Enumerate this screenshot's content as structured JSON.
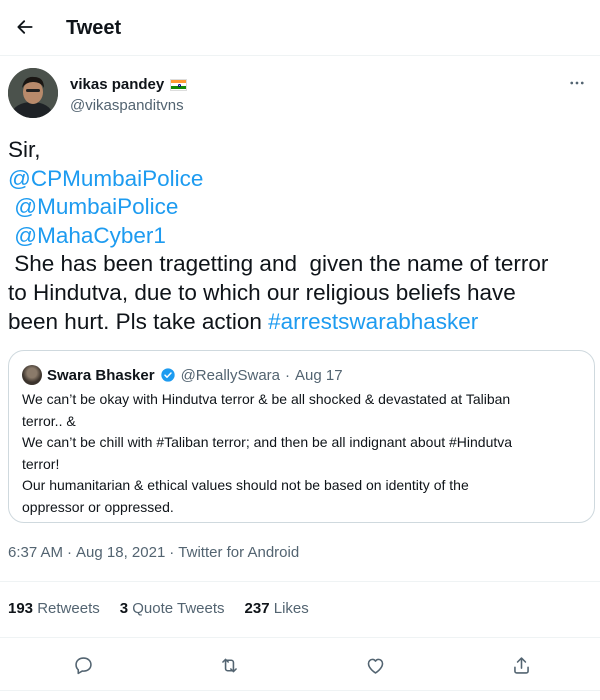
{
  "header": {
    "title": "Tweet"
  },
  "author": {
    "name": "vikas pandey",
    "handle": "@vikaspanditvns"
  },
  "tweet": {
    "lines": [
      [
        {
          "text": "Sir,",
          "link": false
        }
      ],
      [
        {
          "text": "@CPMumbaiPolice",
          "link": true
        }
      ],
      [
        {
          "text": " ",
          "link": false
        },
        {
          "text": "@MumbaiPolice",
          "link": true
        }
      ],
      [
        {
          "text": " ",
          "link": false
        },
        {
          "text": "@MahaCyber1",
          "link": true
        }
      ],
      [
        {
          "text": " She has been tragetting and  given the name of terror",
          "link": false
        }
      ],
      [
        {
          "text": "to Hindutva, due to which our religious beliefs have",
          "link": false
        }
      ],
      [
        {
          "text": "been hurt. Pls take action ",
          "link": false
        },
        {
          "text": "#arrestswarabhasker",
          "link": true
        }
      ]
    ]
  },
  "quote": {
    "name": "Swara Bhasker",
    "handle": "@ReallySwara",
    "separator": "·",
    "date": "Aug 17",
    "body_lines": [
      "We can’t be okay with Hindutva terror & be all shocked & devastated at Taliban",
      "terror.. &",
      "We can’t be chill with #Taliban terror; and then be all indignant about #Hindutva",
      "terror!",
      "Our humanitarian & ethical values should not be based on identity of the",
      "oppressor or oppressed."
    ]
  },
  "meta": {
    "time": "6:37 AM",
    "separator1": "·",
    "date": "Aug 18, 2021",
    "separator2": "·",
    "source": "Twitter for Android"
  },
  "stats": {
    "retweets": {
      "count": "193",
      "label": "Retweets"
    },
    "quotes": {
      "count": "3",
      "label": "Quote Tweets"
    },
    "likes": {
      "count": "237",
      "label": "Likes"
    }
  },
  "icons": [
    "back-arrow-icon",
    "more-icon",
    "verified-badge-icon",
    "reply-icon",
    "retweet-icon",
    "like-icon",
    "share-icon"
  ],
  "colors": {
    "link": "#1d9bf0",
    "secondary_text": "#536471",
    "border": "#cfd9de",
    "verified": "#1d9bf0"
  }
}
